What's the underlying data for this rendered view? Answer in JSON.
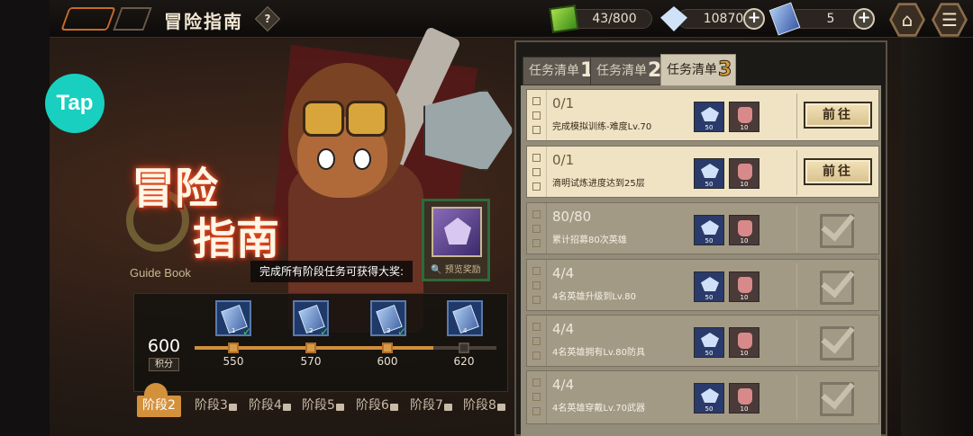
{
  "header": {
    "title": "冒险指南",
    "help_glyph": "?",
    "resources": [
      {
        "name": "energy",
        "icon": "green-cube-icon",
        "value": "43/800"
      },
      {
        "name": "crystal",
        "icon": "crystal-icon",
        "value": "10870"
      },
      {
        "name": "ticket",
        "icon": "ticket-icon",
        "value": "5"
      }
    ],
    "plus_glyph": "+",
    "home_icon": "⌂",
    "menu_icon": "☰"
  },
  "overlay": {
    "tap_logo": "Tap"
  },
  "banner": {
    "title_line1": "冒险",
    "title_line2": "指南",
    "subtitle": "Guide Book",
    "prize_text": "完成所有阶段任务可获得大奖:",
    "prize_view": "🔍 预览奖励"
  },
  "progress": {
    "score": "600",
    "score_label": "积分",
    "fill_fraction": 0.79,
    "milestones": [
      {
        "value": "550",
        "card_num": "1",
        "claimed": true,
        "check": "✓"
      },
      {
        "value": "570",
        "card_num": "2",
        "claimed": true,
        "check": "✓"
      },
      {
        "value": "600",
        "card_num": "3",
        "claimed": true,
        "check": "✓"
      },
      {
        "value": "620",
        "card_num": "4",
        "claimed": false,
        "check": ""
      }
    ]
  },
  "stages": [
    {
      "label": "阶段2",
      "active": true,
      "locked": false
    },
    {
      "label": "阶段3",
      "active": false,
      "locked": true
    },
    {
      "label": "阶段4",
      "active": false,
      "locked": true
    },
    {
      "label": "阶段5",
      "active": false,
      "locked": true
    },
    {
      "label": "阶段6",
      "active": false,
      "locked": true
    },
    {
      "label": "阶段7",
      "active": false,
      "locked": true
    },
    {
      "label": "阶段8",
      "active": false,
      "locked": true
    }
  ],
  "task_tabs": [
    {
      "label": "任务清单",
      "num": "1",
      "active": false
    },
    {
      "label": "任务清单",
      "num": "2",
      "active": false
    },
    {
      "label": "任务清单",
      "num": "3",
      "active": true
    }
  ],
  "tasks": [
    {
      "progress": "0/1",
      "desc": "完成模拟训练-难度Lv.70",
      "status": "open",
      "button": "前往",
      "reward1_qty": "50",
      "reward2_qty": "10"
    },
    {
      "progress": "0/1",
      "desc": "滴明试炼进度达到25层",
      "status": "open",
      "button": "前往",
      "reward1_qty": "50",
      "reward2_qty": "10"
    },
    {
      "progress": "80/80",
      "desc": "累计招募80次英雄",
      "status": "done",
      "button": "",
      "reward1_qty": "50",
      "reward2_qty": "10"
    },
    {
      "progress": "4/4",
      "desc": "4名英雄升级到Lv.80",
      "status": "done",
      "button": "",
      "reward1_qty": "50",
      "reward2_qty": "10"
    },
    {
      "progress": "4/4",
      "desc": "4名英雄拥有Lv.80防具",
      "status": "done",
      "button": "",
      "reward1_qty": "50",
      "reward2_qty": "10"
    },
    {
      "progress": "4/4",
      "desc": "4名英雄穿戴Lv.70武器",
      "status": "done",
      "button": "",
      "reward1_qty": "50",
      "reward2_qty": "10"
    }
  ]
}
